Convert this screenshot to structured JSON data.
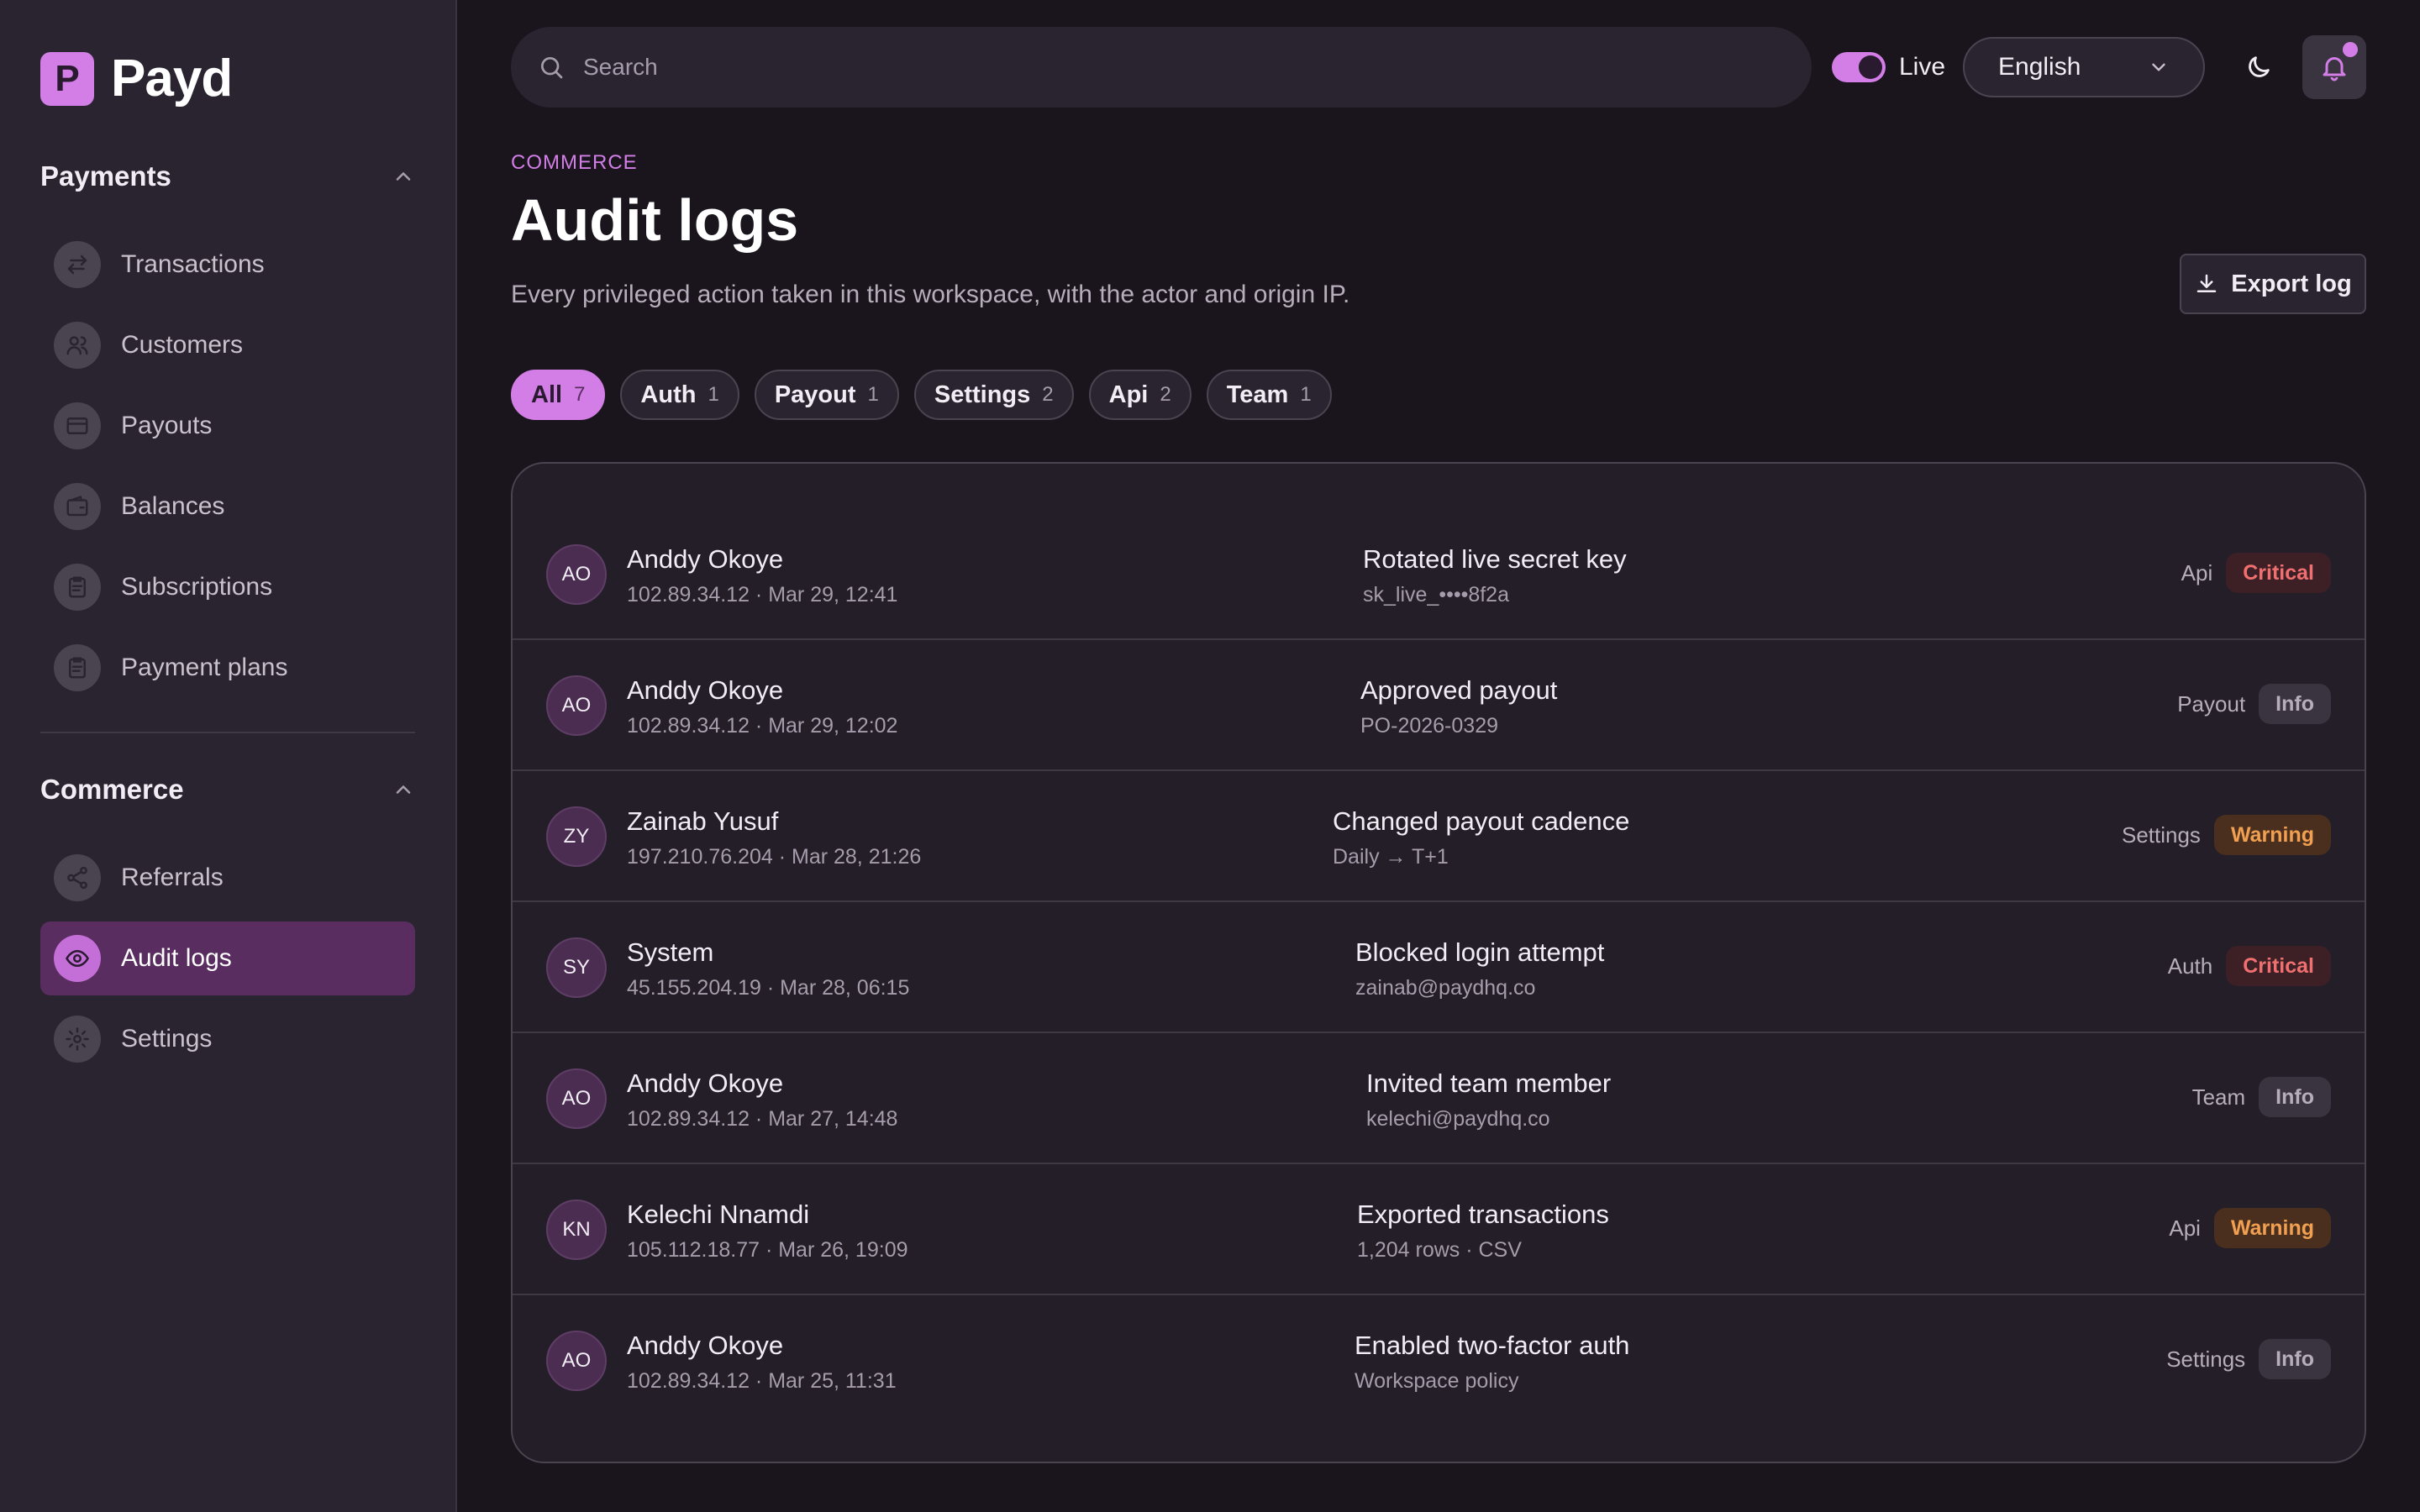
{
  "brand": {
    "name": "Payd",
    "mark": "P"
  },
  "sidebar": {
    "sections": [
      {
        "title": "Payments",
        "items": [
          {
            "label": "Transactions",
            "icon": "arrows-swap-icon"
          },
          {
            "label": "Customers",
            "icon": "users-icon"
          },
          {
            "label": "Payouts",
            "icon": "card-icon"
          },
          {
            "label": "Balances",
            "icon": "wallet-icon"
          },
          {
            "label": "Subscriptions",
            "icon": "clipboard-icon"
          },
          {
            "label": "Payment plans",
            "icon": "clipboard-icon"
          }
        ]
      },
      {
        "title": "Commerce",
        "items": [
          {
            "label": "Referrals",
            "icon": "share-icon"
          },
          {
            "label": "Audit logs",
            "icon": "eye-icon",
            "active": true
          },
          {
            "label": "Settings",
            "icon": "gear-icon"
          }
        ]
      }
    ]
  },
  "topbar": {
    "search_placeholder": "Search",
    "live_label": "Live",
    "live_on": true,
    "language": "English"
  },
  "header": {
    "eyebrow": "COMMERCE",
    "title": "Audit logs",
    "subtitle": "Every privileged action taken in this workspace, with the actor and origin IP.",
    "export_label": "Export log"
  },
  "filters": [
    {
      "label": "All",
      "count": "7",
      "active": true
    },
    {
      "label": "Auth",
      "count": "1"
    },
    {
      "label": "Payout",
      "count": "1"
    },
    {
      "label": "Settings",
      "count": "2"
    },
    {
      "label": "Api",
      "count": "2"
    },
    {
      "label": "Team",
      "count": "1"
    }
  ],
  "logs": [
    {
      "initials": "AO",
      "actor": "Anddy Okoye",
      "meta": "102.89.34.12 · Mar 29, 12:41",
      "action": "Rotated live secret key",
      "detail": "sk_live_••••8f2a",
      "category": "Api",
      "severity": "Critical"
    },
    {
      "initials": "AO",
      "actor": "Anddy Okoye",
      "meta": "102.89.34.12 · Mar 29, 12:02",
      "action": "Approved payout",
      "detail": "PO-2026-0329",
      "category": "Payout",
      "severity": "Info"
    },
    {
      "initials": "ZY",
      "actor": "Zainab Yusuf",
      "meta": "197.210.76.204 · Mar 28, 21:26",
      "action": "Changed payout cadence",
      "detail": "Daily → T+1",
      "category": "Settings",
      "severity": "Warning"
    },
    {
      "initials": "SY",
      "actor": "System",
      "meta": "45.155.204.19 · Mar 28, 06:15",
      "action": "Blocked login attempt",
      "detail": "zainab@paydhq.co",
      "category": "Auth",
      "severity": "Critical"
    },
    {
      "initials": "AO",
      "actor": "Anddy Okoye",
      "meta": "102.89.34.12 · Mar 27, 14:48",
      "action": "Invited team member",
      "detail": "kelechi@paydhq.co",
      "category": "Team",
      "severity": "Info"
    },
    {
      "initials": "KN",
      "actor": "Kelechi Nnamdi",
      "meta": "105.112.18.77 · Mar 26, 19:09",
      "action": "Exported transactions",
      "detail": "1,204 rows · CSV",
      "category": "Api",
      "severity": "Warning"
    },
    {
      "initials": "AO",
      "actor": "Anddy Okoye",
      "meta": "102.89.34.12 · Mar 25, 11:31",
      "action": "Enabled two-factor auth",
      "detail": "Workspace policy",
      "category": "Settings",
      "severity": "Info"
    }
  ],
  "colors": {
    "accent": "#d27ee6",
    "critical": "#f07070",
    "warning": "#f0a050",
    "background": "#1a151d"
  }
}
